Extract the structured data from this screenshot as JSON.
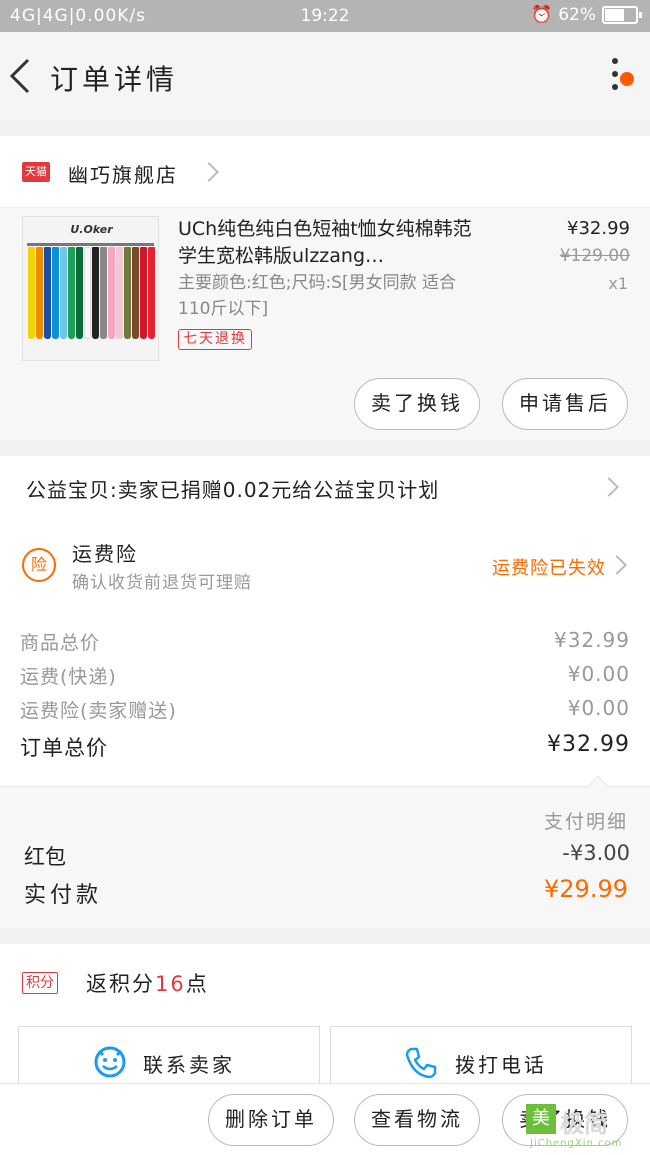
{
  "status_bar": {
    "left": "4G|4G|0.00K/s",
    "time": "19:22",
    "battery": "62%",
    "battery_level": 0.62
  },
  "header": {
    "title": "订单详情"
  },
  "shop": {
    "badge": "天猫",
    "name": "幽巧旗舰店"
  },
  "product": {
    "image_brand": "U.Oker",
    "title": "UCh纯色纯白色短袖t恤女纯棉韩范学生宽松韩版ulzzang…",
    "spec": "主要颜色:红色;尺码:S[男女同款 适合110斤以下]",
    "tag": "七天退换",
    "price": "¥32.99",
    "original_price": "¥129.00",
    "quantity": "x1",
    "buttons": {
      "refund": "卖了换钱",
      "after_sale": "申请售后"
    },
    "shirt_colors": [
      "#f4d20a",
      "#f08c00",
      "#1a4fa8",
      "#0c8ed8",
      "#6ec6e8",
      "#1ea05a",
      "#0d6b3a",
      "#f7f7f7",
      "#222222",
      "#888888",
      "#f4a6c0",
      "#f0c8d8",
      "#6e7a3a",
      "#7a4a2a",
      "#d4142a",
      "#e82030"
    ]
  },
  "charity": {
    "text": "公益宝贝:卖家已捐赠0.02元给公益宝贝计划"
  },
  "insurance": {
    "badge": "险",
    "title": "运费险",
    "subtitle": "确认收货前退货可理赔",
    "status": "运费险已失效"
  },
  "summary": {
    "goods_label": "商品总价",
    "goods_value": "¥32.99",
    "shipping_label": "运费(快递)",
    "shipping_value": "¥0.00",
    "insurance_label": "运费险(卖家赠送)",
    "insurance_value": "¥0.00",
    "total_label": "订单总价",
    "total_value": "¥32.99"
  },
  "payment": {
    "title": "支付明细",
    "red_packet_label": "红包",
    "red_packet_value": "-¥3.00",
    "paid_label": "实付款",
    "paid_value": "¥29.99"
  },
  "points": {
    "badge": "积分",
    "prefix": "返积分",
    "number": "16",
    "suffix": "点"
  },
  "contact": {
    "seller": "联系卖家",
    "call": "拨打电话"
  },
  "bottom": {
    "delete": "删除订单",
    "logistics": "查看物流",
    "sell": "卖了换钱"
  },
  "watermark": {
    "logo_char": "美",
    "text": "极简",
    "url": "JiChengXin.com"
  }
}
